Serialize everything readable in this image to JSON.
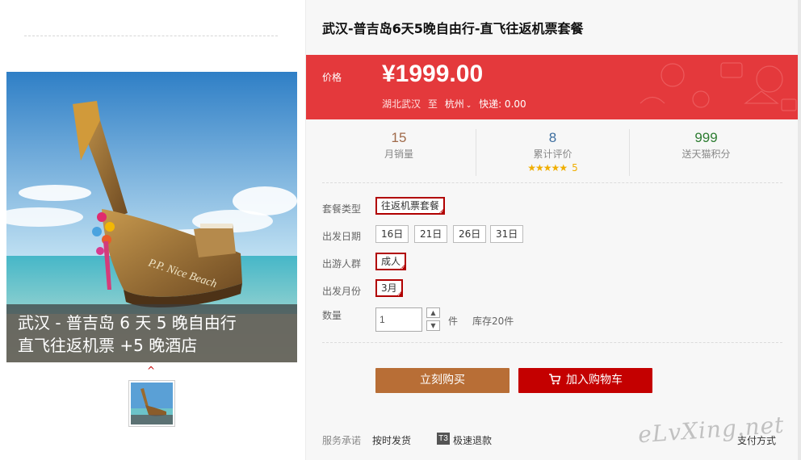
{
  "product": {
    "title": "武汉-普吉岛6天5晚自由行-直飞往返机票套餐",
    "image_caption": {
      "line1": "武汉 - 普吉岛 6 天 5 晚自由行",
      "line2": "直飞往返机票 +5 晚酒店"
    },
    "image_boat_text": "P.P. Nice Beach"
  },
  "price_box": {
    "label": "价格",
    "price": "¥1999.00",
    "origin": "湖北武汉",
    "to_word": "至",
    "destination": "杭州",
    "shipping_fee": "快递: 0.00"
  },
  "stats": {
    "sales": {
      "value": "15",
      "label": "月销量"
    },
    "reviews": {
      "value": "8",
      "label": "累计评价",
      "stars": "★★★★★",
      "score": "5"
    },
    "points": {
      "value": "999",
      "label": "送天猫积分"
    }
  },
  "options": {
    "package_type": {
      "label": "套餐类型",
      "values": [
        "往返机票套餐"
      ]
    },
    "departure_date": {
      "label": "出发日期",
      "values": [
        "16日",
        "21日",
        "26日",
        "31日"
      ]
    },
    "travelers": {
      "label": "出游人群",
      "values": [
        "成人"
      ]
    },
    "departure_month": {
      "label": "出发月份",
      "values": [
        "3月"
      ]
    }
  },
  "quantity": {
    "label": "数量",
    "value": "1",
    "unit": "件",
    "stock": "库存20件"
  },
  "actions": {
    "buy_now": "立刻购买",
    "add_to_cart": "加入购物车"
  },
  "services": {
    "label": "服务承诺",
    "ontime": "按时发货",
    "t3_badge": "T3",
    "fast_refund": "极速退款",
    "payment": "支付方式"
  },
  "watermark": "eLvXing.net",
  "colors": {
    "price_red": "#e4393c",
    "buy_now_brown": "#b86e36",
    "cart_red": "#c40000",
    "selected_border": "#b10000",
    "star_gold": "#f0ae00"
  },
  "icons": {
    "cart": "shopping-cart-icon",
    "dropdown": "chevron-down-icon",
    "thumb_up_arrow": "caret-up-icon"
  }
}
